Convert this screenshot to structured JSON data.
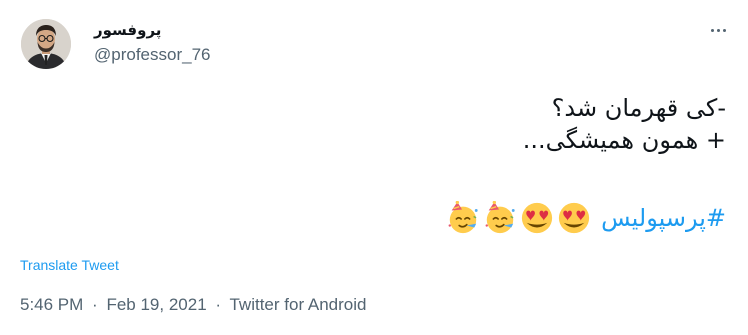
{
  "user": {
    "display_name": "پروفسور",
    "handle": "@professor_76"
  },
  "tweet": {
    "lines": [
      "-کی قهرمان شد؟",
      "+ همون همیشگی..."
    ],
    "hashtag": "#پرسپولیس",
    "emojis": [
      "heart-eyes-face-icon",
      "heart-eyes-face-icon",
      "partying-face-icon",
      "partying-face-icon"
    ]
  },
  "translate_label": "Translate Tweet",
  "meta": {
    "time": "5:46 PM",
    "separator": "·",
    "date": "Feb 19, 2021",
    "source": "Twitter for Android"
  },
  "colors": {
    "link": "#1d9bf0",
    "secondary_text": "#536471",
    "primary_text": "#0f1419"
  }
}
